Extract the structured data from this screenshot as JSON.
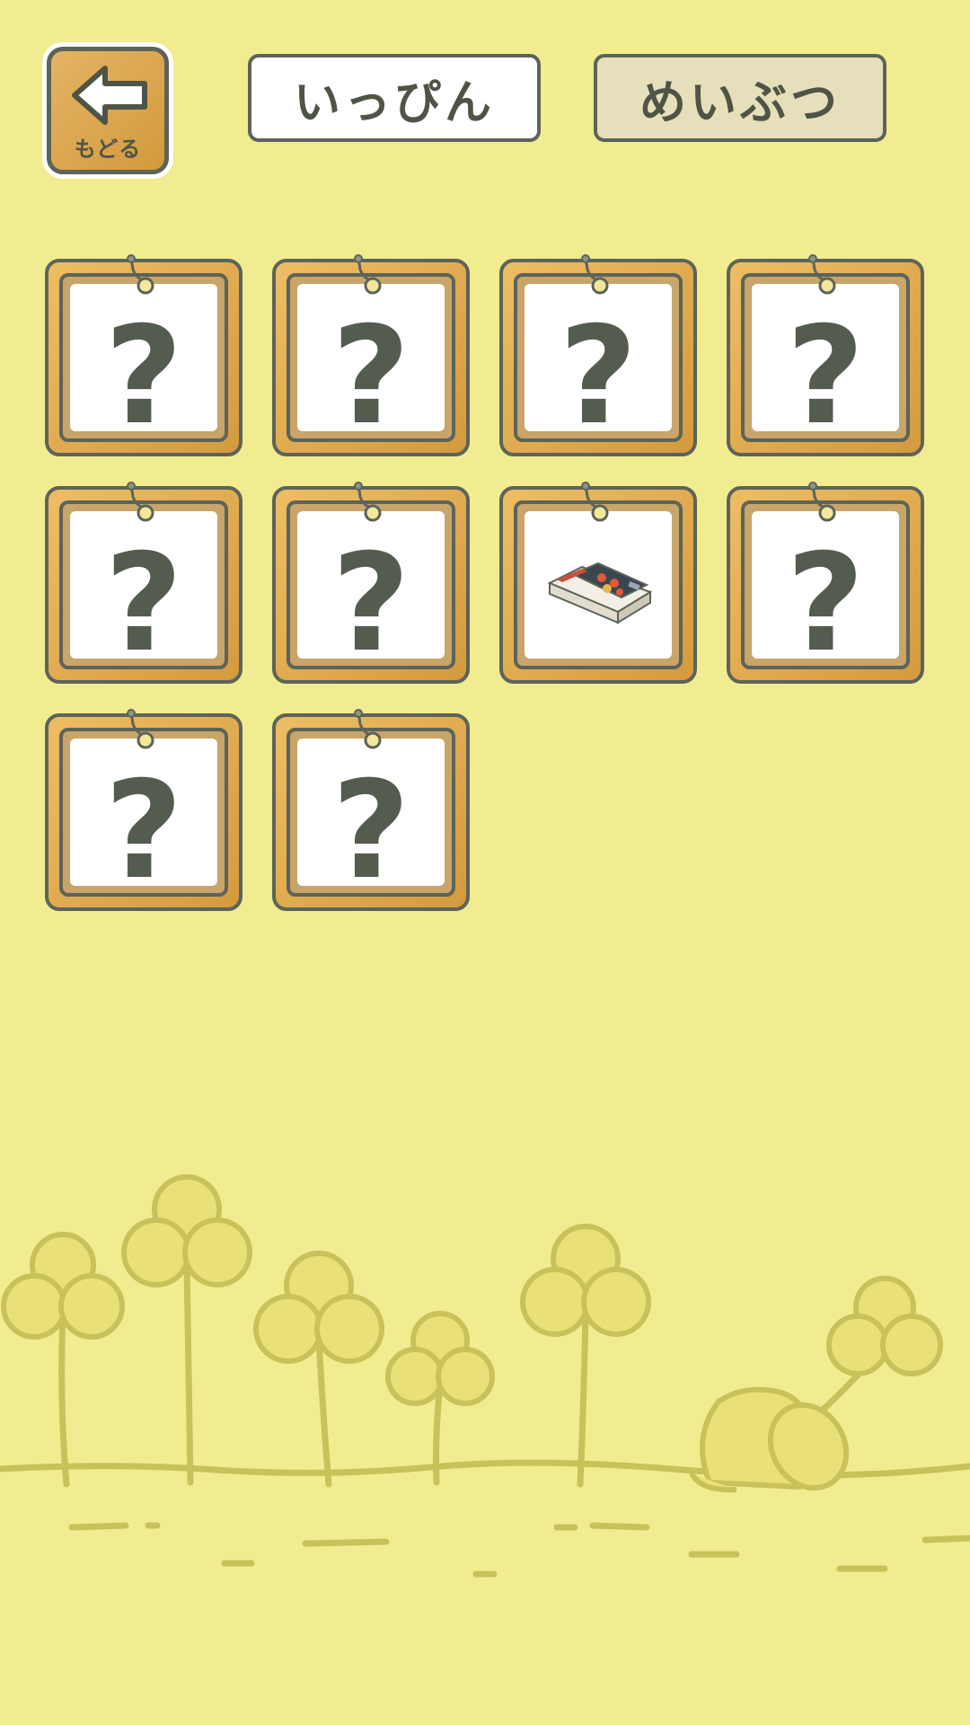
{
  "header": {
    "back_label": "もどる",
    "tabs": [
      {
        "label": "いっぴん",
        "selected": false
      },
      {
        "label": "めいぶつ",
        "selected": true
      }
    ]
  },
  "collection": {
    "items": [
      {
        "state": "locked",
        "label": "?"
      },
      {
        "state": "locked",
        "label": "?"
      },
      {
        "state": "locked",
        "label": "?"
      },
      {
        "state": "locked",
        "label": "?"
      },
      {
        "state": "locked",
        "label": "?"
      },
      {
        "state": "locked",
        "label": "?"
      },
      {
        "state": "unlocked",
        "icon": "matchbox-icon"
      },
      {
        "state": "locked",
        "label": "?"
      },
      {
        "state": "locked",
        "label": "?"
      },
      {
        "state": "locked",
        "label": "?"
      }
    ]
  },
  "colors": {
    "background": "#f2ec91",
    "frame_wood": "#d9a347",
    "outline": "#5c6459",
    "scene_line": "#c9c15a"
  }
}
